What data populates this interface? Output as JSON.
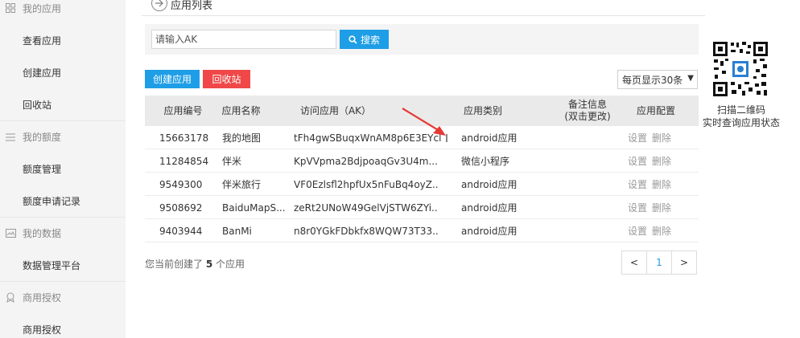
{
  "sidebar": {
    "groups": [
      {
        "label": "我的应用",
        "icon": "grid-icon",
        "items": [
          "查看应用",
          "创建应用",
          "回收站"
        ]
      },
      {
        "label": "我的额度",
        "icon": "list-icon",
        "items": [
          "额度管理",
          "额度申请记录"
        ]
      },
      {
        "label": "我的数据",
        "icon": "image-icon",
        "items": [
          "数据管理平台"
        ]
      },
      {
        "label": "商用授权",
        "icon": "badge-icon",
        "items": [
          "商用授权"
        ]
      }
    ]
  },
  "header": {
    "title": "应用列表"
  },
  "search": {
    "placeholder": "请输入AK",
    "button_label": "搜索"
  },
  "toolbar": {
    "create_label": "创建应用",
    "recycle_label": "回收站",
    "per_page": "每页显示30条"
  },
  "table": {
    "headers": [
      "应用编号",
      "应用名称",
      "访问应用（AK）",
      "应用类别",
      "备注信息\n(双击更改)",
      "应用配置"
    ],
    "rows": [
      {
        "id": "15663178",
        "name": "我的地图",
        "ak": "tFh4gwSBuqxWnAM8p6E3EYcl",
        "type": "android应用",
        "ops": [
          "设置",
          "删除"
        ]
      },
      {
        "id": "11284854",
        "name": "伴米",
        "ak": "KpVVpma2BdjpoaqGv3U4m...",
        "type": "微信小程序",
        "ops": [
          "设置",
          "删除"
        ]
      },
      {
        "id": "9549300",
        "name": "伴米旅行",
        "ak": "VF0Ezlsfl2hpfUx5nFuBq4oyZ...",
        "type": "android应用",
        "ops": [
          "设置",
          "删除"
        ]
      },
      {
        "id": "9508692",
        "name": "BaiduMapS...",
        "ak": "zeRt2UNoW49GelVjSTW6ZYi...",
        "type": "android应用",
        "ops": [
          "设置",
          "删除"
        ]
      },
      {
        "id": "9403944",
        "name": "BanMi",
        "ak": "n8r0YGkFDbkfx8WQW73T33...",
        "type": "android应用",
        "ops": [
          "设置",
          "删除"
        ]
      }
    ]
  },
  "footer": {
    "prefix": "您当前创建了",
    "count": "5",
    "suffix": "个应用"
  },
  "pager": {
    "prev": "<",
    "current": "1",
    "next": ">"
  },
  "qr": {
    "caption_line1": "扫描二维码",
    "caption_line2": "实时查询应用状态"
  },
  "colors": {
    "accent": "#1e9ee6",
    "danger": "#f04848",
    "arrow": "#e53935"
  }
}
